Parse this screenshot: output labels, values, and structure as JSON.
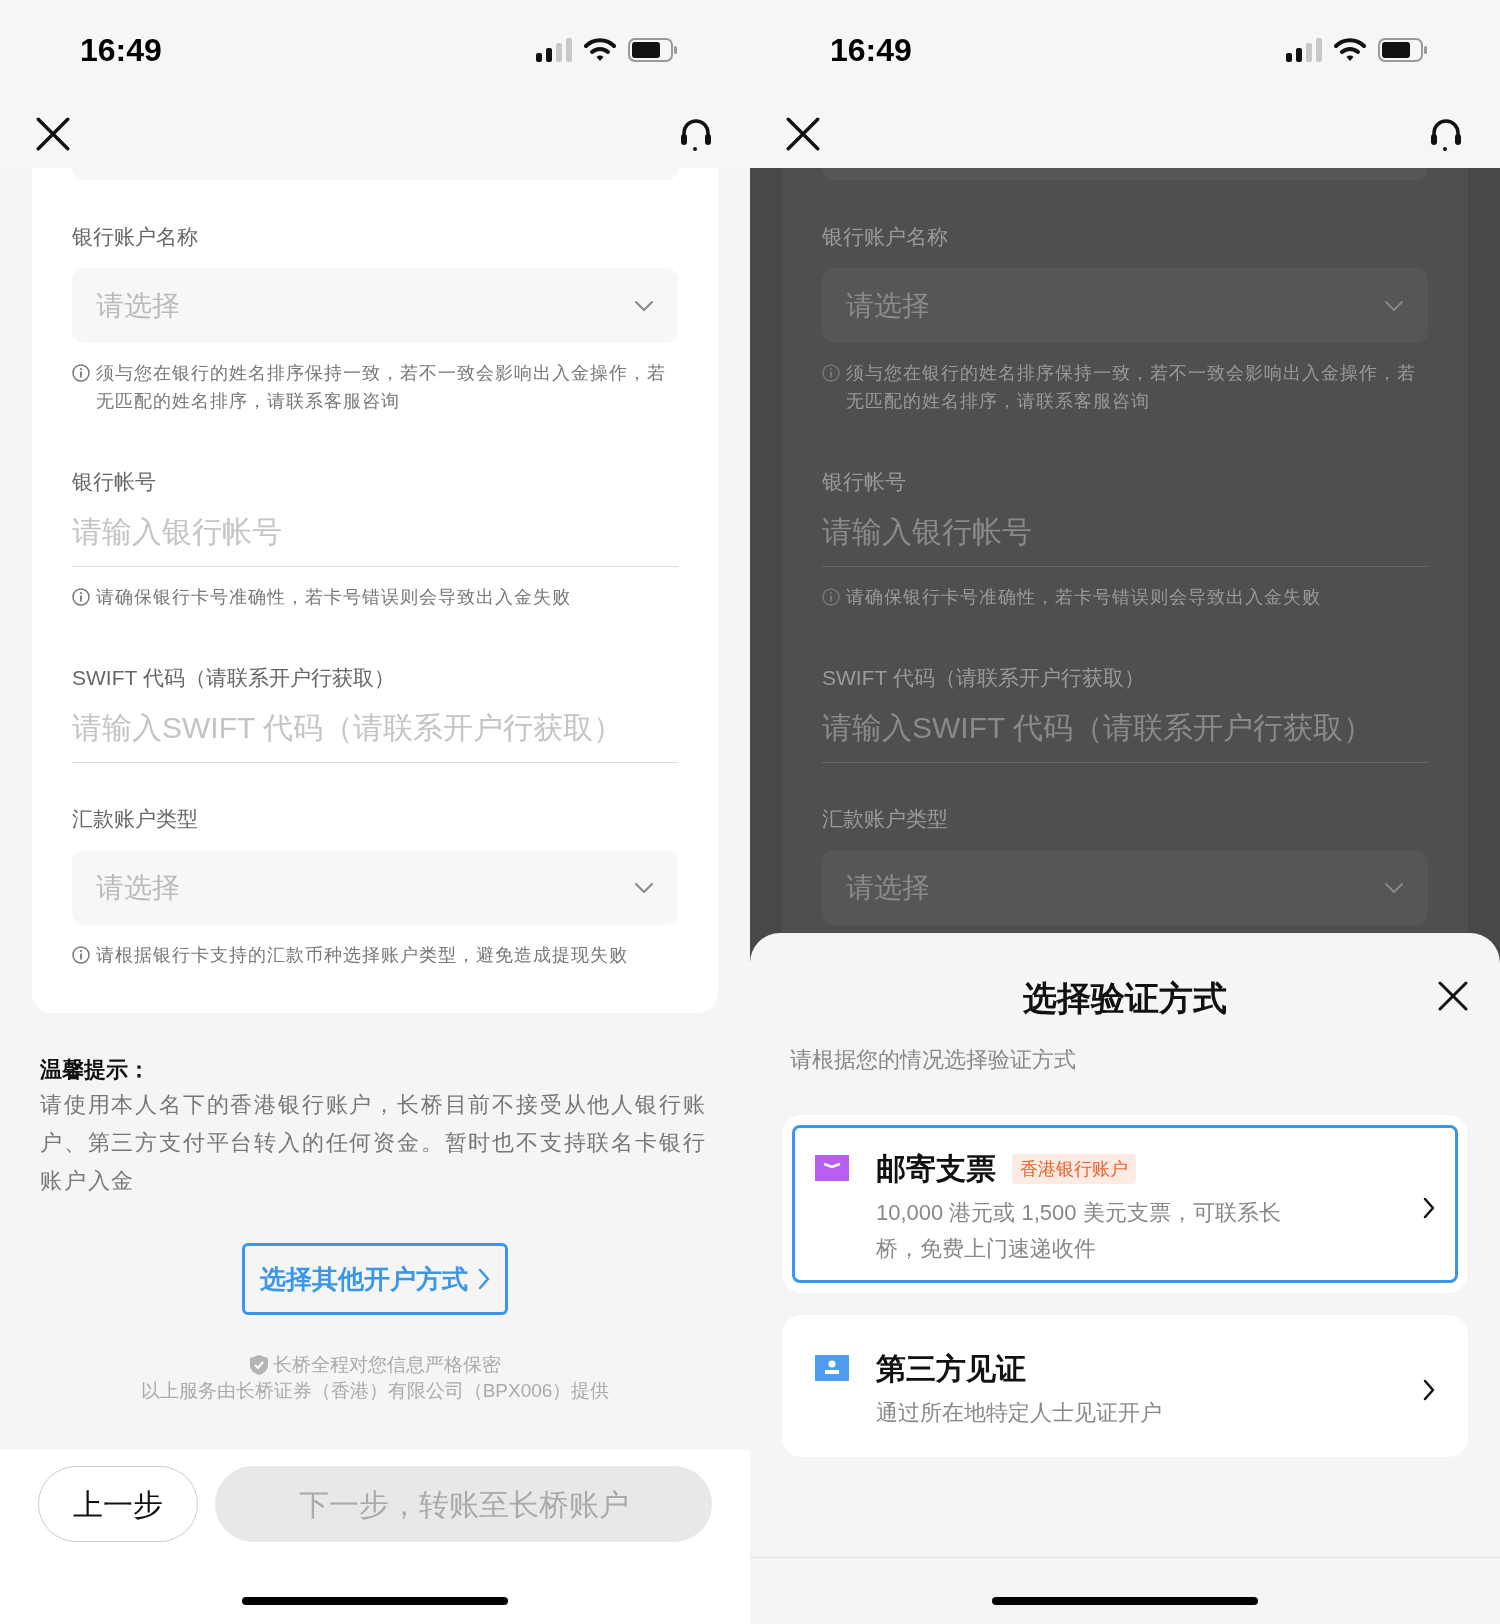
{
  "screens": [
    {
      "status_bar": {
        "time": "16:49"
      },
      "form": {
        "fields": [
          {
            "kind": "select",
            "label": "银行账户名称",
            "placeholder": "请选择",
            "hint": "须与您在银行的姓名排序保持一致，若不一致会影响出入金操作，若无匹配的姓名排序，请联系客服咨询"
          },
          {
            "kind": "input",
            "label": "银行帐号",
            "placeholder": "请输入银行帐号",
            "hint": "请确保银行卡号准确性，若卡号错误则会导致出入金失败"
          },
          {
            "kind": "input",
            "label": "SWIFT 代码（请联系开户行获取）",
            "placeholder": "请输入SWIFT 代码（请联系开户行获取）"
          },
          {
            "kind": "select",
            "label": "汇款账户类型",
            "placeholder": "请选择",
            "hint": "请根据银行卡支持的汇款币种选择账户类型，避免造成提现失败"
          }
        ]
      },
      "tips": {
        "title": "温馨提示：",
        "text": "请使用本人名下的香港银行账户，长桥目前不接受从他人银行账户、第三方支付平台转入的任何资金。暂时也不支持联名卡银行账户入金"
      },
      "other_method_button": "选择其他开户方式",
      "privacy_note": "长桥全程对您信息严格保密",
      "provider_note": "以上服务由长桥证券（香港）有限公司（BPX006）提供",
      "footer": {
        "back_button": "上一步",
        "next_button": {
          "label": "下一步，转账至长桥账户",
          "disabled": true
        }
      }
    },
    {
      "status_bar": {
        "time": "16:49"
      },
      "form": {
        "fields": [
          {
            "kind": "select",
            "label": "银行账户名称",
            "placeholder": "请选择",
            "hint": "须与您在银行的姓名排序保持一致，若不一致会影响出入金操作，若无匹配的姓名排序，请联系客服咨询"
          },
          {
            "kind": "input",
            "label": "银行帐号",
            "placeholder": "请输入银行帐号",
            "hint": "请确保银行卡号准确性，若卡号错误则会导致出入金失败"
          },
          {
            "kind": "input",
            "label": "SWIFT 代码（请联系开户行获取）",
            "placeholder": "请输入SWIFT 代码（请联系开户行获取）"
          },
          {
            "kind": "select",
            "label": "汇款账户类型",
            "placeholder": "请选择"
          }
        ]
      },
      "sheet": {
        "title": "选择验证方式",
        "subtitle": "请根据您的情况选择验证方式",
        "options": [
          {
            "kind": "mail",
            "title": "邮寄支票",
            "tag": "香港银行账户",
            "description": "10,000 港元或 1,500 美元支票，可联系长桥，免费上门速递收件",
            "selected": true
          },
          {
            "kind": "witness",
            "title": "第三方见证",
            "description": "通过所在地特定人士见证开户",
            "selected": false
          }
        ]
      }
    }
  ]
}
